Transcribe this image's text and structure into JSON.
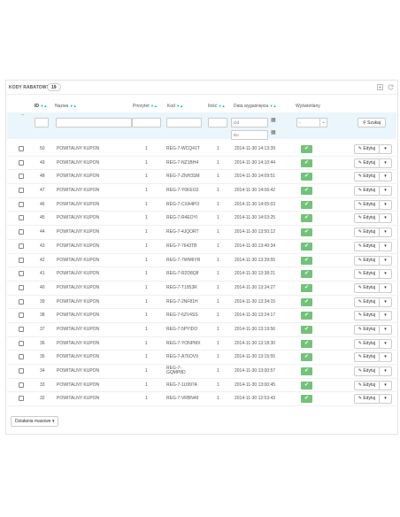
{
  "panel": {
    "title": "KODY RABATOWE",
    "count": "19",
    "add_icon": "plus-square-icon",
    "refresh_icon": "refresh-icon"
  },
  "columns": {
    "id": "ID",
    "name": "Nazwa",
    "priority": "Priorytet",
    "code": "Kod",
    "quantity": "Ilość",
    "expiry": "Data wygaśnięcia",
    "displayed": "Wyświetlany"
  },
  "filters": {
    "dash": "--",
    "from_placeholder": "Od",
    "to_placeholder": "Do",
    "displayed_value": "-",
    "search_label": "Szukaj"
  },
  "colors": {
    "accent": "#00aff0",
    "status_ok": "#72c279",
    "filter_bg": "#eaf6fc"
  },
  "rows": [
    {
      "id": "50",
      "name": "POWITALNY KUPON",
      "priority": "1",
      "code": "REG-7-WCQ41T",
      "qty": "1",
      "date": "2014-11-30 14:13:39",
      "edit": "Edytuj"
    },
    {
      "id": "49",
      "name": "POWITALNY KUPON",
      "priority": "1",
      "code": "REG-7-NZ1BH4",
      "qty": "1",
      "date": "2014-11-30 14:10:44",
      "edit": "Edytuj"
    },
    {
      "id": "48",
      "name": "POWITALNY KUPON",
      "priority": "1",
      "code": "REG-7-ZNH3SM",
      "qty": "1",
      "date": "2014-11-30 14:09:51",
      "edit": "Edytuj"
    },
    {
      "id": "47",
      "name": "POWITALNY KUPON",
      "priority": "1",
      "code": "REG-7-Y6KEO2",
      "qty": "1",
      "date": "2014-11-30 14:06:42",
      "edit": "Edytuj"
    },
    {
      "id": "46",
      "name": "POWITALNY KUPON",
      "priority": "1",
      "code": "REG-7-CXA4PO",
      "qty": "1",
      "date": "2014-11-30 14:05:03",
      "edit": "Edytuj"
    },
    {
      "id": "45",
      "name": "POWITALNY KUPON",
      "priority": "1",
      "code": "REG-7-R4EOYI",
      "qty": "1",
      "date": "2014-11-30 14:03:25",
      "edit": "Edytuj"
    },
    {
      "id": "44",
      "name": "POWITALNY KUPON",
      "priority": "1",
      "code": "REG-7-4JQORT",
      "qty": "1",
      "date": "2014-11-30 13:50:12",
      "edit": "Edytuj"
    },
    {
      "id": "43",
      "name": "POWITALNY KUPON",
      "priority": "1",
      "code": "REG-7-7643TB",
      "qty": "1",
      "date": "2014-11-30 13:40:34",
      "edit": "Edytuj"
    },
    {
      "id": "42",
      "name": "POWITALNY KUPON",
      "priority": "1",
      "code": "REG-7-7WM6YR",
      "qty": "1",
      "date": "2014-11-30 13:39:55",
      "edit": "Edytuj"
    },
    {
      "id": "41",
      "name": "POWITALNY KUPON",
      "priority": "1",
      "code": "REG-7-R2D8Q8",
      "qty": "1",
      "date": "2014-11-30 13:38:21",
      "edit": "Edytuj"
    },
    {
      "id": "40",
      "name": "POWITALNY KUPON",
      "priority": "1",
      "code": "REG-7-T1953R",
      "qty": "1",
      "date": "2014-11-30 13:34:27",
      "edit": "Edytuj"
    },
    {
      "id": "39",
      "name": "POWITALNY KUPON",
      "priority": "1",
      "code": "REG-7-2NF81H",
      "qty": "1",
      "date": "2014-11-30 13:34:15",
      "edit": "Edytuj"
    },
    {
      "id": "38",
      "name": "POWITALNY KUPON",
      "priority": "1",
      "code": "REG-7-6ZV4SS",
      "qty": "1",
      "date": "2014-11-30 13:24:17",
      "edit": "Edytuj"
    },
    {
      "id": "37",
      "name": "POWITALNY KUPON",
      "priority": "1",
      "code": "REG-7-5PYIDO",
      "qty": "1",
      "date": "2014-11-30 13:19:56",
      "edit": "Edytuj"
    },
    {
      "id": "36",
      "name": "POWITALNY KUPON",
      "priority": "1",
      "code": "REG-7-YONPMX",
      "qty": "1",
      "date": "2014-11-30 13:18:30",
      "edit": "Edytuj"
    },
    {
      "id": "35",
      "name": "POWITALNY KUPON",
      "priority": "1",
      "code": "REG-7-A76OV9",
      "qty": "1",
      "date": "2014-11-30 13:15:55",
      "edit": "Edytuj"
    },
    {
      "id": "34",
      "name": "POWITALNY KUPON",
      "priority": "1",
      "code": "REG-7-",
      "code2": "GQMP8D",
      "qty": "1",
      "date": "2014-11-30 13:00:57",
      "edit": "Edytuj"
    },
    {
      "id": "33",
      "name": "POWITALNY KUPON",
      "priority": "1",
      "code": "REG-7-1U997A",
      "qty": "1",
      "date": "2014-11-30 13:00:45",
      "edit": "Edytuj"
    },
    {
      "id": "32",
      "name": "POWITALNY KUPON",
      "priority": "1",
      "code": "REG-7-VRBN49",
      "qty": "1",
      "date": "2014-11-30 12:53:43",
      "edit": "Edytuj"
    }
  ],
  "bulk_actions": "Działania masowe"
}
